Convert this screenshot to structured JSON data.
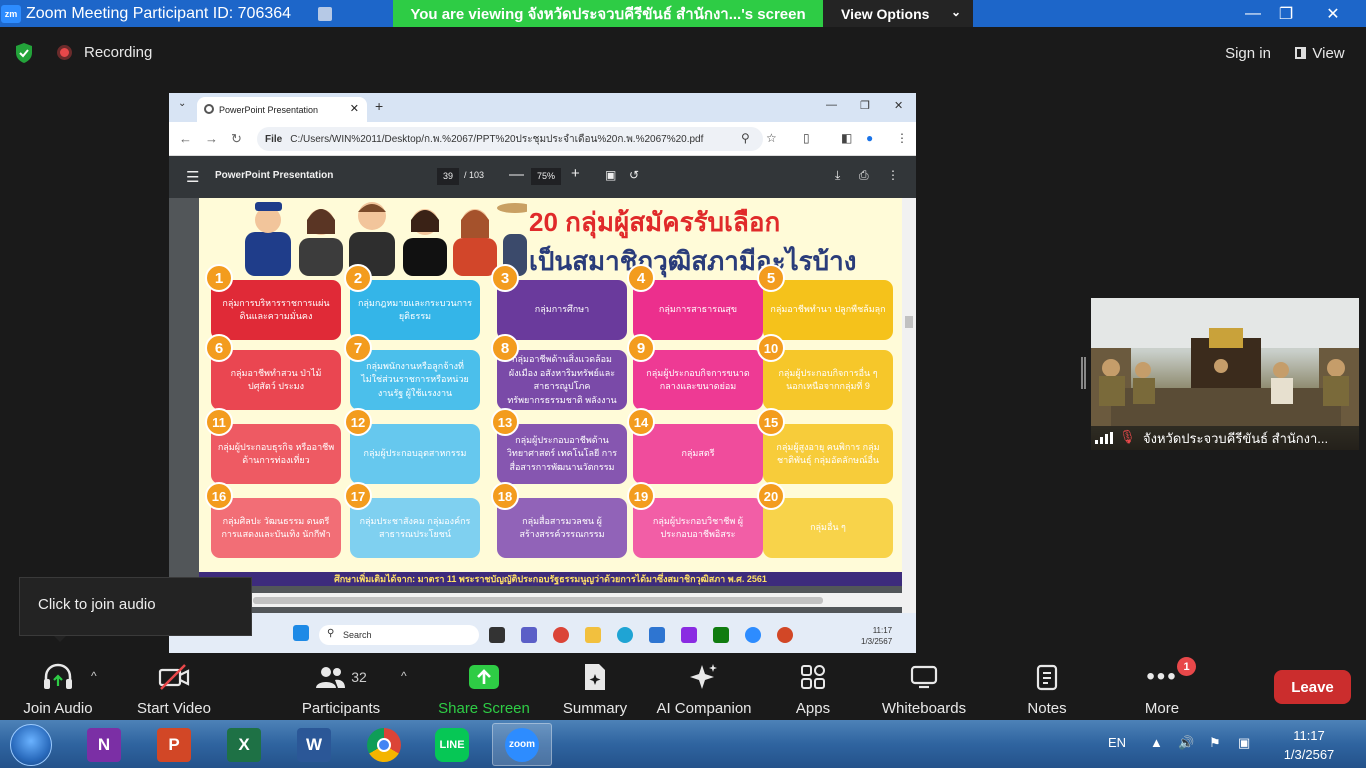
{
  "window": {
    "title": "Zoom Meeting Participant ID: 706364",
    "logo": "zm",
    "banner": "You  are  viewing  จังหวัดประจวบคีรีขันธ์  สำนักงา...'s  screen",
    "view_options": "View Options",
    "controls": {
      "minimize": "—",
      "restore": "❐",
      "close": "✕"
    }
  },
  "topbar": {
    "recording": "Recording",
    "sign_in": "Sign in",
    "view": "View"
  },
  "shared_screen": {
    "browser": {
      "tab_title": "PowerPoint Presentation",
      "tab_close": "✕",
      "new_tab": "+",
      "dropdown": "⌄",
      "url_scheme": "File",
      "url": "C:/Users/WIN%2011/Desktop/ก.พ.%2067/PPT%20ประชุมประจำเดือน%20ก.พ.%2067%20.pdf"
    },
    "pdf_viewer": {
      "title": "PowerPoint Presentation",
      "page": "39",
      "total": "/ 103",
      "zoom": "75%",
      "minus": "—",
      "plus": "+"
    },
    "slide": {
      "title_line_1": "20 กลุ่มผู้สมัครรับเลือก",
      "title_line_2": "เป็นสมาชิกวุฒิสภามีอะไรบ้าง",
      "footer": "ศึกษาเพิ่มเติมได้จาก: มาตรา 11 พระราชบัญญัติประกอบรัฐธรรมนูญว่าด้วยการได้มาซึ่งสมาชิกวุฒิสภา พ.ศ. 2561",
      "groups": [
        {
          "num": "1",
          "label": "กลุ่มการบริหารราชการแผ่นดินและความมั่นคง",
          "color": "#e02a37"
        },
        {
          "num": "2",
          "label": "กลุ่มกฎหมายและกระบวนการยุติธรรม",
          "color": "#34b5e8"
        },
        {
          "num": "3",
          "label": "กลุ่มการศึกษา",
          "color": "#6a3a9c"
        },
        {
          "num": "4",
          "label": "กลุ่มการสาธารณสุข",
          "color": "#ec2f8d"
        },
        {
          "num": "5",
          "label": "กลุ่มอาชีพทำนา ปลูกพืชล้มลุก",
          "color": "#f5c21b"
        },
        {
          "num": "6",
          "label": "กลุ่มอาชีพทำสวน ป่าไม้ ปศุสัตว์ ประมง",
          "color": "#ea4651"
        },
        {
          "num": "7",
          "label": "กลุ่มพนักงานหรือลูกจ้างที่ไม่ใช่ส่วนราชการหรือหน่วยงานรัฐ ผู้ใช้แรงงาน",
          "color": "#4bbfeb"
        },
        {
          "num": "8",
          "label": "กลุ่มอาชีพด้านสิ่งแวดล้อม ผังเมือง อสังหาริมทรัพย์และสาธารณูปโภค ทรัพยากรธรรมชาติ พลังงาน",
          "color": "#7a4aa8"
        },
        {
          "num": "9",
          "label": "กลุ่มผู้ประกอบกิจการขนาดกลางและขนาดย่อม",
          "color": "#ee3a94"
        },
        {
          "num": "10",
          "label": "กลุ่มผู้ประกอบกิจการอื่น ๆ นอกเหนือจากกลุ่มที่ 9",
          "color": "#f6c72a"
        },
        {
          "num": "11",
          "label": "กลุ่มผู้ประกอบธุรกิจ หรืออาชีพด้านการท่องเที่ยว",
          "color": "#ee5a63"
        },
        {
          "num": "12",
          "label": "กลุ่มผู้ประกอบอุตสาหกรรม",
          "color": "#66c8ee"
        },
        {
          "num": "13",
          "label": "กลุ่มผู้ประกอบอาชีพด้านวิทยาศาสตร์ เทคโนโลยี การสื่อสารการพัฒนานวัตกรรม",
          "color": "#8656b0"
        },
        {
          "num": "14",
          "label": "กลุ่มสตรี",
          "color": "#f04c9c"
        },
        {
          "num": "15",
          "label": "กลุ่มผู้สูงอายุ คนพิการ กลุ่มชาติพันธุ์ กลุ่มอัตลักษณ์อื่น",
          "color": "#f7cc3a"
        },
        {
          "num": "16",
          "label": "กลุ่มศิลปะ วัฒนธรรม ดนตรี การแสดงและบันเทิง นักกีฬา",
          "color": "#f26e76"
        },
        {
          "num": "17",
          "label": "กลุ่มประชาสังคม กลุ่มองค์กรสาธารณประโยชน์",
          "color": "#7fd0f0"
        },
        {
          "num": "18",
          "label": "กลุ่มสื่อสารมวลชน ผู้สร้างสรรค์วรรณกรรม",
          "color": "#9163b8"
        },
        {
          "num": "19",
          "label": "กลุ่มผู้ประกอบวิชาชีพ ผู้ประกอบอาชีพอิสระ",
          "color": "#f25ea6"
        },
        {
          "num": "20",
          "label": "กลุ่มอื่น ๆ",
          "color": "#f8d34a"
        }
      ]
    },
    "inner_taskbar": {
      "search": "Search",
      "time": "11:17",
      "date": "1/3/2567"
    }
  },
  "audio_tooltip": "Click to join audio",
  "video": {
    "participant_name": "จังหวัดประจวบคีรีขันธ์ สำนักงา..."
  },
  "toolbar": {
    "join_audio": "Join Audio",
    "start_video": "Start Video",
    "participants": "Participants",
    "participants_count": "32",
    "share_screen": "Share Screen",
    "summary": "Summary",
    "ai_companion": "AI Companion",
    "apps": "Apps",
    "whiteboards": "Whiteboards",
    "notes": "Notes",
    "more": "More",
    "more_badge": "1",
    "leave": "Leave",
    "caret": "^"
  },
  "taskbar": {
    "apps": [
      {
        "name": "onenote",
        "letter": "N",
        "color": "#7b2fa5"
      },
      {
        "name": "powerpoint",
        "letter": "P",
        "color": "#d24726"
      },
      {
        "name": "excel",
        "letter": "X",
        "color": "#1e7145"
      },
      {
        "name": "word",
        "letter": "W",
        "color": "#2b5797"
      },
      {
        "name": "chrome",
        "letter": "",
        "color": "#db4437"
      },
      {
        "name": "line",
        "letter": "LINE",
        "color": "#06c755"
      },
      {
        "name": "zoom",
        "letter": "zoom",
        "color": "#2d8cff"
      }
    ],
    "lang": "EN",
    "time": "11:17",
    "date": "1/3/2567"
  },
  "colors": {
    "zoom_blue": "#1d66c9",
    "share_green": "#2ecc45",
    "leave_red": "#cb2d2d"
  }
}
